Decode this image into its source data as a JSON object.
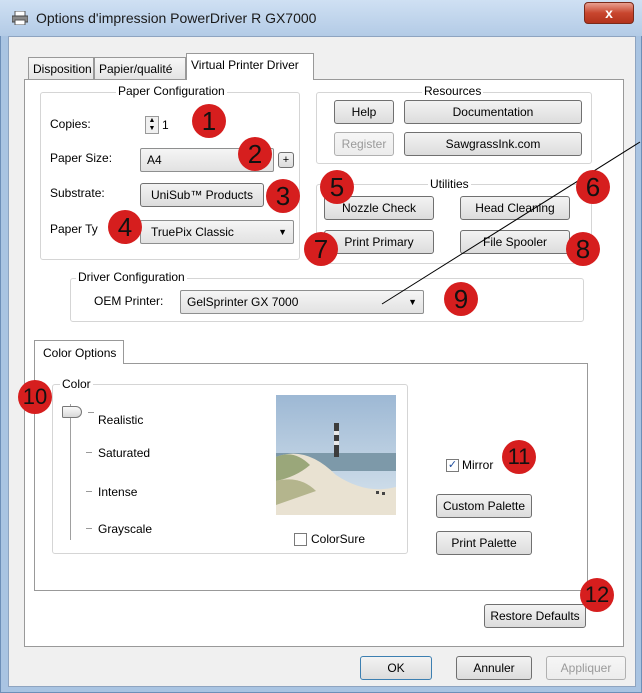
{
  "window": {
    "title": "Options d'impression PowerDriver R GX7000",
    "close_label": "x"
  },
  "tabs": [
    "Disposition",
    "Papier/qualité",
    "Virtual Printer Driver"
  ],
  "paper_configuration": {
    "title": "Paper Configuration",
    "copies_label": "Copies:",
    "copies_value": "1",
    "paper_size_label": "Paper Size:",
    "paper_size_value": "A4",
    "paper_size_plus": "+",
    "substrate_label": "Substrate:",
    "substrate_value": "UniSub™ Products",
    "paper_type_label": "Paper Ty",
    "paper_type_value": "TruePix Classic"
  },
  "resources": {
    "title": "Resources",
    "help": "Help",
    "documentation": "Documentation",
    "register": "Register",
    "sawgrass": "SawgrassInk.com"
  },
  "utilities": {
    "title": "Utilities",
    "nozzle_check": "Nozzle Check",
    "head_cleaning": "Head Cleaning",
    "print_primary": "Print Primary",
    "file_spooler": "File Spooler"
  },
  "driver_configuration": {
    "title": "Driver Configuration",
    "oem_label": "OEM Printer:",
    "oem_value": "GelSprinter GX 7000"
  },
  "color_options": {
    "tab": "Color Options",
    "group_title": "Color",
    "levels": [
      "Realistic",
      "Saturated",
      "Intense",
      "Grayscale"
    ],
    "selected_level": "Realistic",
    "colorsure_label": "ColorSure",
    "colorsure_checked": false,
    "mirror_label": "Mirror",
    "mirror_checked": true,
    "custom_palette": "Custom Palette",
    "print_palette": "Print Palette"
  },
  "restore_defaults": "Restore Defaults",
  "footer": {
    "ok": "OK",
    "cancel": "Annuler",
    "apply": "Appliquer"
  },
  "markers": [
    "1",
    "2",
    "3",
    "4",
    "5",
    "6",
    "7",
    "8",
    "9",
    "10",
    "11",
    "12"
  ],
  "colors": {
    "marker": "#d61e1e",
    "window_frame": "#a9c4e2",
    "close_button": "#c8462e"
  }
}
